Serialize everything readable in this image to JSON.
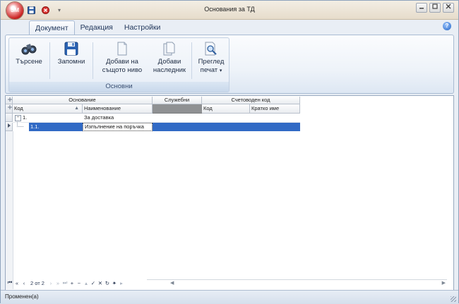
{
  "window": {
    "title": "Основания за ТД",
    "app_badge": "SM",
    "controls": [
      "minimize",
      "maximize",
      "close"
    ]
  },
  "quick_access": {
    "save_icon": "floppy-icon",
    "cancel_icon": "red-x-icon",
    "customize_symbol": "▾"
  },
  "tabs": [
    {
      "label": "Документ",
      "active": true
    },
    {
      "label": "Редакция",
      "active": false
    },
    {
      "label": "Настройки",
      "active": false
    }
  ],
  "ribbon": {
    "group_label": "Основни",
    "buttons": {
      "search": {
        "line1": "Търсене",
        "line2": "",
        "icon": "binoculars-icon"
      },
      "save": {
        "line1": "Запомни",
        "line2": "",
        "icon": "floppy-icon"
      },
      "add_same_level": {
        "line1": "Добави на",
        "line2": "същото ниво",
        "icon": "document-icon"
      },
      "add_child": {
        "line1": "Добави",
        "line2": "наследник",
        "icon": "document-copy-icon"
      },
      "print_preview": {
        "line1": "Преглед",
        "line2": "печат",
        "icon": "print-preview-icon",
        "has_dropdown": true
      }
    }
  },
  "grid": {
    "bands": {
      "osnovanie": "Основание",
      "sluzhebni": "Служебни",
      "schetovoden_kod": "Счетоводен код"
    },
    "columns": {
      "kod": "Код",
      "naimenovanie": "Наименование",
      "sch_kod": "Код",
      "kratko_ime": "Кратко име"
    },
    "rows": [
      {
        "kod": "1.",
        "naimenovanie": "За доставка",
        "expanded": true,
        "selected": false
      },
      {
        "kod": "1.1.",
        "naimenovanie": "Изпълнение на поръчка",
        "expanded": false,
        "selected": true
      }
    ]
  },
  "navigator": {
    "record_text": "2 от 2"
  },
  "status": {
    "text": "Променен(а)"
  },
  "colors": {
    "selection": "#316ac5",
    "ribbon_text": "#1f2d44",
    "tab_text": "#20365a"
  }
}
